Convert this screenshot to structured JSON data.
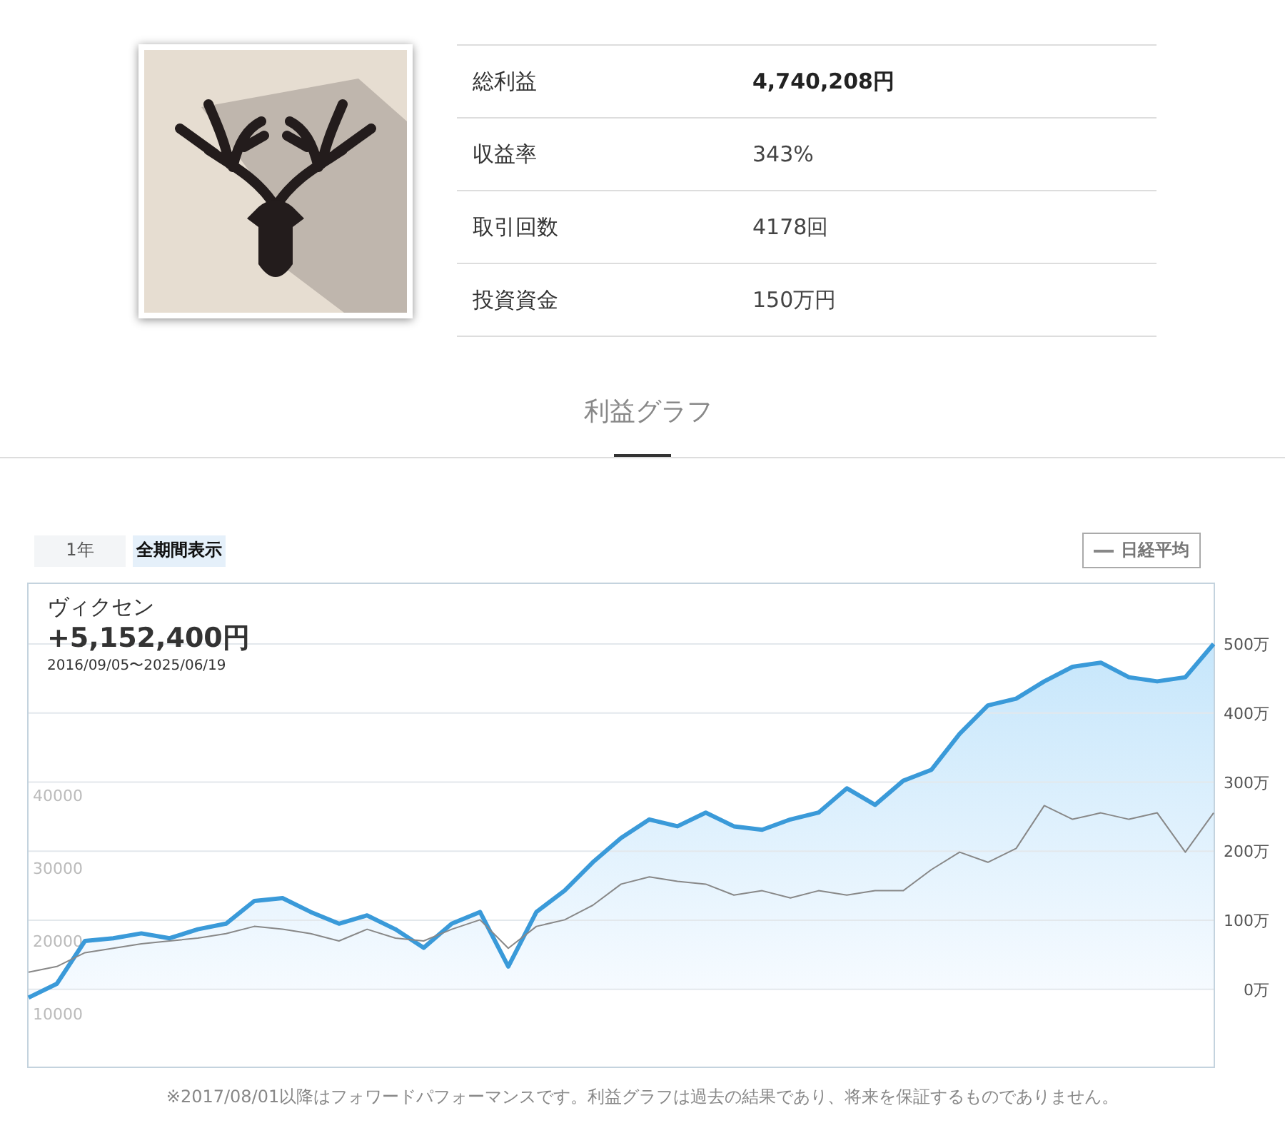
{
  "profile": {
    "stats": [
      {
        "label": "総利益",
        "value": "4,740,208円",
        "kind": "total"
      },
      {
        "label": "収益率",
        "value": "343%",
        "kind": "plain"
      },
      {
        "label": "取引回数",
        "value": "4178回",
        "kind": "plain"
      },
      {
        "label": "投資資金",
        "value": "150万円",
        "kind": "plain"
      }
    ]
  },
  "section_title": "利益グラフ",
  "period_tabs": [
    {
      "label": "1年",
      "selected": false
    },
    {
      "label": "全期間表示",
      "selected": true
    }
  ],
  "chart": {
    "total": "+5,152,400円",
    "period": "2016/09/05〜2025/06/19",
    "chart_data": {
      "type": "area",
      "grid": true,
      "ylim": [
        -114,
        589
      ],
      "yticks": [
        {
          "value": 0,
          "label": "0万"
        },
        {
          "value": 100,
          "label": "100万"
        },
        {
          "value": 200,
          "label": "200万"
        },
        {
          "value": 300,
          "label": "300万"
        },
        {
          "value": 400,
          "label": "400万"
        },
        {
          "value": 500,
          "label": "500万"
        }
      ],
      "y2lim": [
        2550,
        69220
      ],
      "y2ticks": [
        10000,
        20000,
        30000,
        40000
      ],
      "series": [
        {
          "name": "ヴィクセン",
          "color": "#3a9ad9",
          "values": [
            -12,
            8,
            70,
            74,
            81,
            74,
            87,
            95,
            128,
            132,
            112,
            95,
            107,
            87,
            60,
            95,
            112,
            33,
            112,
            143,
            184,
            219,
            246,
            236,
            256,
            236,
            231,
            246,
            256,
            291,
            267,
            302,
            318,
            370,
            411,
            421,
            446,
            467,
            473,
            452,
            446,
            452,
            500
          ]
        },
        {
          "name": "日経平均",
          "color": "#888888",
          "axis": "y2",
          "type": "line",
          "values": [
            15700,
            16500,
            18400,
            19000,
            19600,
            20000,
            20400,
            21000,
            22000,
            21600,
            21000,
            20000,
            21600,
            20400,
            20000,
            21600,
            22900,
            19000,
            22000,
            22900,
            24900,
            27800,
            28800,
            28200,
            27800,
            26300,
            26900,
            25900,
            26900,
            26300,
            26900,
            26900,
            29800,
            32200,
            30800,
            32700,
            38600,
            36700,
            37600,
            36700,
            37600,
            32200,
            37600
          ]
        }
      ]
    }
  },
  "footnote": "※2017/08/01以降はフォワードパフォーマンスです。利益グラフは過去の結果であり、将来を保証するものでありません。"
}
